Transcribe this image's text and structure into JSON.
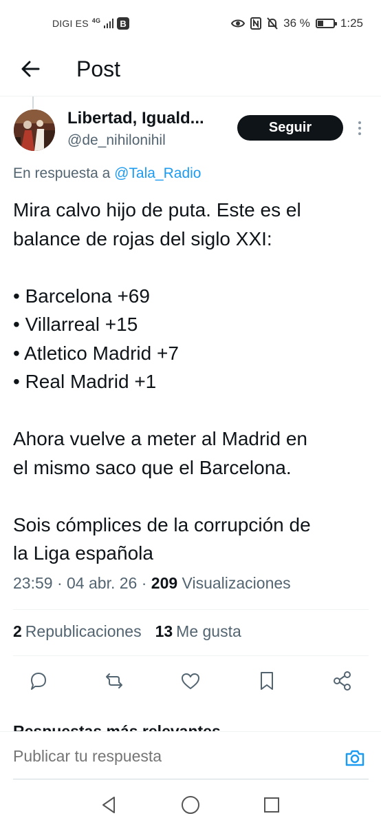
{
  "status_bar": {
    "carrier": "DIGI ES",
    "network": "4G",
    "b_badge": "B",
    "battery": "36 %",
    "battery_level": 0.36,
    "time": "1:25"
  },
  "header": {
    "title": "Post"
  },
  "tweet": {
    "author_name": "Libertad, Iguald...",
    "handle": "@de_nihilonihil",
    "follow_label": "Seguir",
    "reply_prefix": "En respuesta a ",
    "reply_mention": "@Tala_Radio",
    "lines": [
      "Mira calvo hijo de puta. Este es el",
      "balance de rojas del siglo XXI:",
      "",
      "• Barcelona +69",
      "• Villarreal +15",
      "• Atletico Madrid +7",
      "• Real Madrid +1",
      "",
      "Ahora vuelve a meter al Madrid en",
      "el mismo saco que el Barcelona.",
      "",
      "Sois cómplices de la corrupción de",
      "la Liga española"
    ],
    "time": "23:59",
    "date": "04 abr. 26",
    "views_count": "209",
    "views_label": "Visualizaciones",
    "reposts_count": "2",
    "reposts_label": "Republicaciones",
    "likes_count": "13",
    "likes_label": "Me gusta"
  },
  "actions": [
    {
      "name": "reply",
      "icon": "reply-icon"
    },
    {
      "name": "repost",
      "icon": "repost-icon"
    },
    {
      "name": "like",
      "icon": "heart-icon"
    },
    {
      "name": "bookmark",
      "icon": "bookmark-icon"
    },
    {
      "name": "share",
      "icon": "share-icon"
    }
  ],
  "replies_section": {
    "label": "Respuestas más relevantes"
  },
  "composer": {
    "placeholder": "Publicar tu respuesta"
  },
  "colors": {
    "accent": "#1d9bf0",
    "text": "#0f1419",
    "secondary": "#536471"
  }
}
